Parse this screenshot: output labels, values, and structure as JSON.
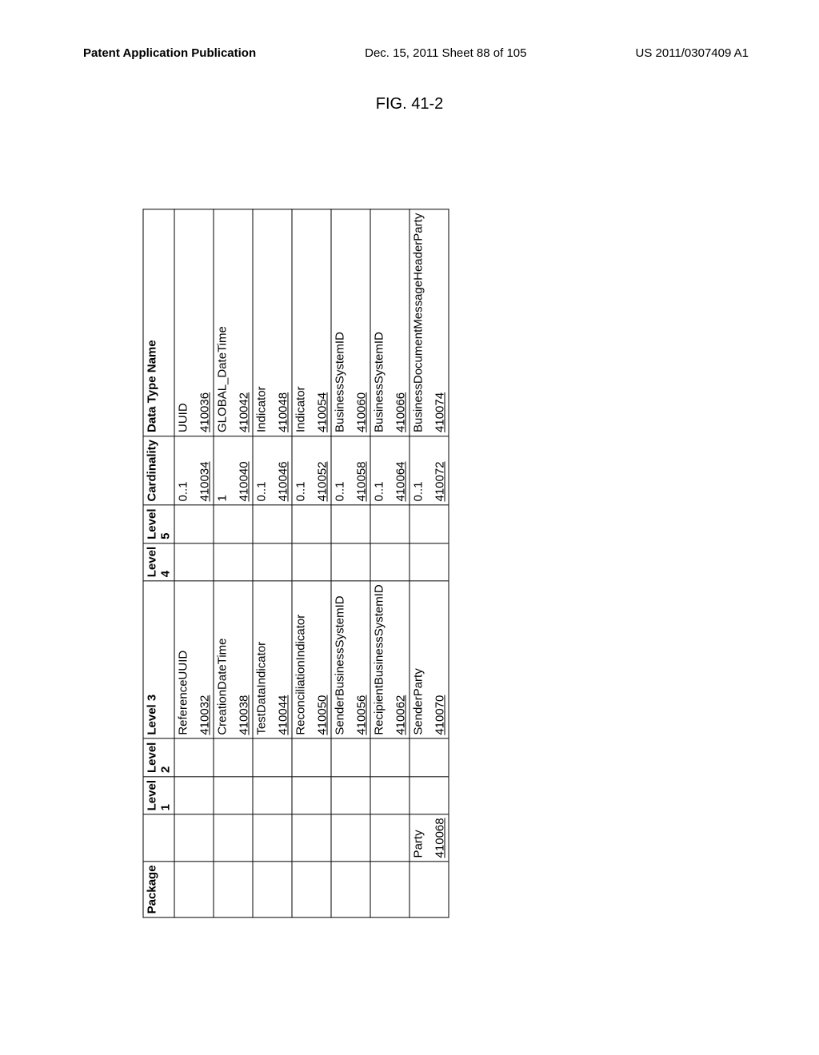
{
  "header": {
    "left": "Patent Application Publication",
    "center": "Dec. 15, 2011  Sheet 88 of 105",
    "right": "US 2011/0307409 A1"
  },
  "figure_title": "FIG. 41-2",
  "columns": {
    "h0": "Package",
    "h1": "",
    "h2": "Level 1",
    "h3": "Level 2",
    "h4": "Level 3",
    "h5": "Level 4",
    "h6": "Level 5",
    "h7": "Cardinality",
    "h8": "Data Type Name"
  },
  "rows": [
    {
      "package_label": "",
      "package_ref": "",
      "level3": "ReferenceUUID",
      "level3_ref": "410032",
      "cardinality": "0..1",
      "cardinality_ref": "410034",
      "datatype": "UUID",
      "datatype_ref": "410036"
    },
    {
      "package_label": "",
      "package_ref": "",
      "level3": "CreationDateTime",
      "level3_ref": "410038",
      "cardinality": "1",
      "cardinality_ref": "410040",
      "datatype": "GLOBAL_DateTime",
      "datatype_ref": "410042"
    },
    {
      "package_label": "",
      "package_ref": "",
      "level3": "TestDataIndicator",
      "level3_ref": "410044",
      "cardinality": "0..1",
      "cardinality_ref": "410046",
      "datatype": "Indicator",
      "datatype_ref": "410048"
    },
    {
      "package_label": "",
      "package_ref": "",
      "level3": "ReconciliationIndicator",
      "level3_ref": "410050",
      "cardinality": "0..1",
      "cardinality_ref": "410052",
      "datatype": "Indicator",
      "datatype_ref": "410054"
    },
    {
      "package_label": "",
      "package_ref": "",
      "level3": "SenderBusinessSystemID",
      "level3_ref": "410056",
      "cardinality": "0..1",
      "cardinality_ref": "410058",
      "datatype": "BusinessSystemID",
      "datatype_ref": "410060"
    },
    {
      "package_label": "",
      "package_ref": "",
      "level3": "RecipientBusinessSystemID",
      "level3_ref": "410062",
      "cardinality": "0..1",
      "cardinality_ref": "410064",
      "datatype": "BusinessSystemID",
      "datatype_ref": "410066"
    },
    {
      "package_label": "Party",
      "package_ref": "410068",
      "level3": "SenderParty",
      "level3_ref": "410070",
      "cardinality": "0..1",
      "cardinality_ref": "410072",
      "datatype": "BusinessDocumentMessageHeaderParty",
      "datatype_ref": "410074"
    }
  ]
}
